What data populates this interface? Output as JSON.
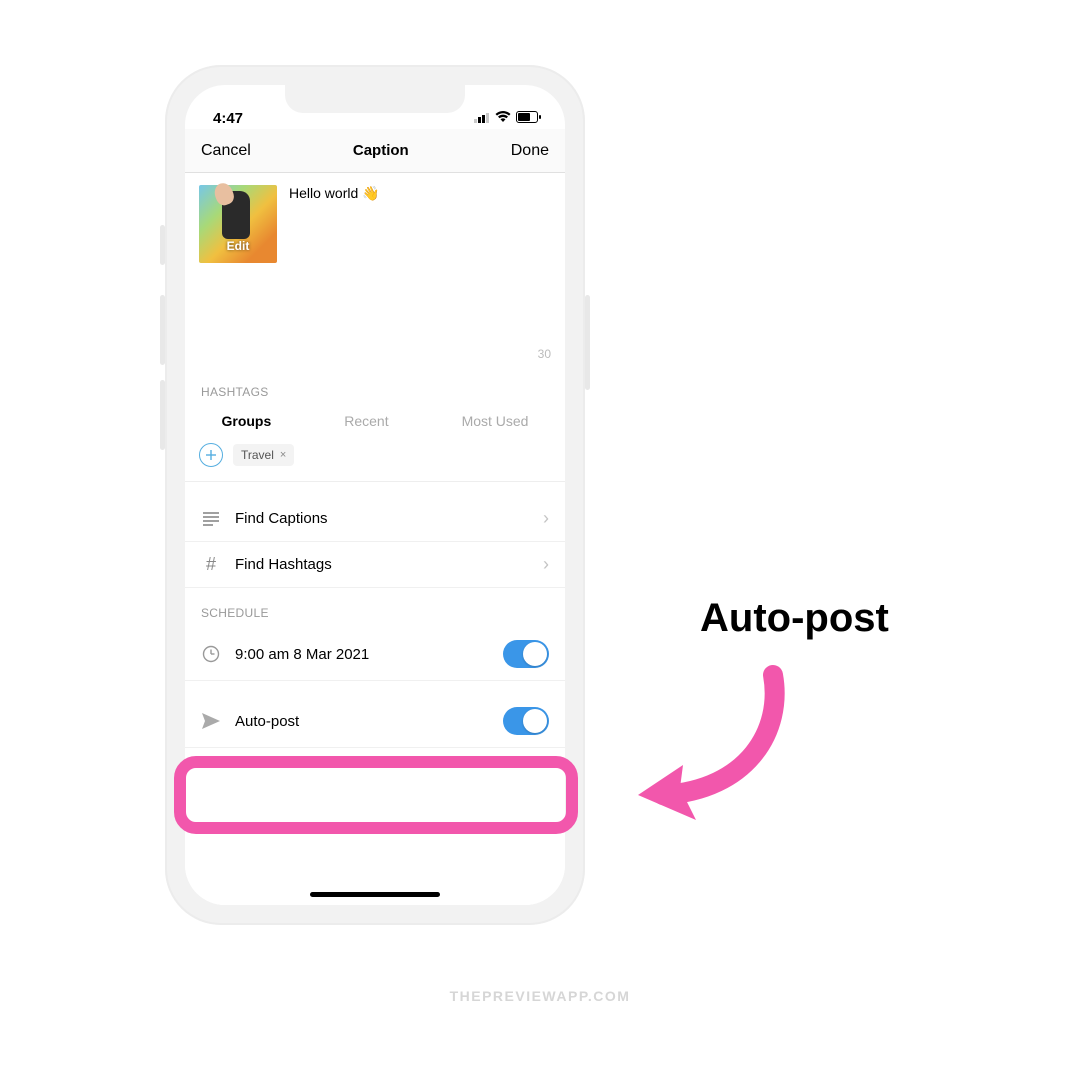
{
  "status": {
    "time": "4:47"
  },
  "nav": {
    "cancel": "Cancel",
    "title": "Caption",
    "done": "Done"
  },
  "editor": {
    "thumb_overlay": "Edit",
    "caption": "Hello world 👋",
    "count": "30"
  },
  "hashtags": {
    "header": "HASHTAGS",
    "tabs": {
      "groups": "Groups",
      "recent": "Recent",
      "most_used": "Most Used"
    },
    "chip": {
      "label": "Travel",
      "close": "×"
    }
  },
  "rows": {
    "find_captions": "Find Captions",
    "find_hashtags": "Find Hashtags"
  },
  "schedule": {
    "header": "SCHEDULE",
    "time": "9:00 am  8 Mar 2021",
    "autopost": "Auto-post"
  },
  "annotation": "Auto-post",
  "watermark": "THEPREVIEWAPP.COM"
}
